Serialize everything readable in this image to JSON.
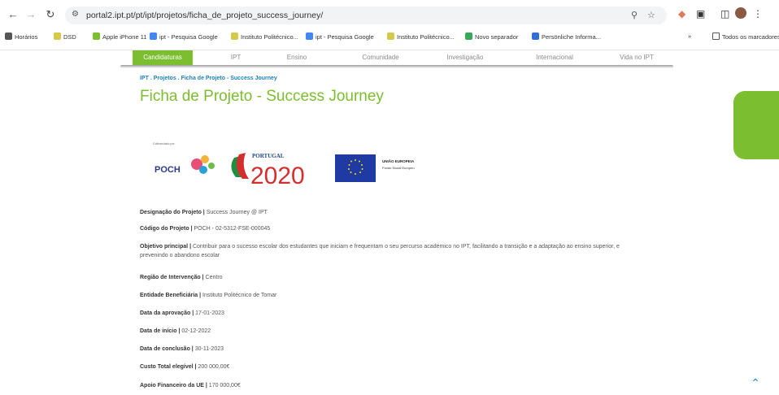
{
  "browser": {
    "url": "portal2.ipt.pt/pt/ipt/projetos/ficha_de_projeto_success_journey/",
    "bookmarks": [
      {
        "label": "Horários",
        "color": "#555"
      },
      {
        "label": "DSD",
        "color": "#d6c94a"
      },
      {
        "label": "Apple iPhone 11",
        "color": "#7bbe2f"
      },
      {
        "label": "ipt - Pesquisa Google",
        "color": "#4285f4"
      },
      {
        "label": "Instituto Politécnico...",
        "color": "#d6c94a"
      },
      {
        "label": "ipt - Pesquisa Google",
        "color": "#4285f4"
      },
      {
        "label": "Instituto Politécnico...",
        "color": "#d6c94a"
      },
      {
        "label": "Novo separador",
        "color": "#3aa757"
      },
      {
        "label": "Persönliche Informa...",
        "color": "#2f6fd6"
      }
    ],
    "bookmarks_more": "»",
    "bookmarks_folder": "Todos os marcadores"
  },
  "site_nav": {
    "items": [
      "Candidaturas",
      "IPT",
      "Ensino",
      "Comunidade",
      "Investigação",
      "Internacional",
      "Vida no IPT"
    ],
    "active_index": 0,
    "accent": "#7bbe2f"
  },
  "page": {
    "breadcrumb": "IPT . Projetos . Ficha de Projeto - Success Journey",
    "title": "Ficha de Projeto - Success Journey",
    "logos": {
      "cofinanced_label": "Cofinanciado por:",
      "poch": "POCH",
      "portugal": "PORTUGAL",
      "year": "2020",
      "eu_title": "UNIÃO EUROPEIA",
      "eu_sub": "Fundo Social Europeu"
    },
    "fields": [
      {
        "label": "Designação do Projeto |",
        "value": " Success Journey @ IPT"
      },
      {
        "label": "Código do Projeto |",
        "value": " POCH - 02-5312-FSE-000045"
      },
      {
        "label": "Objetivo principal |",
        "value": " Contribuir para o sucesso escolar dos estudantes que iniciam e frequentam o seu percurso académico no IPT, facilitando a transição e a adaptação ao ensino superior, e prevenindo o abandono escolar"
      },
      {
        "label": "Região de Intervenção |",
        "value": " Centro"
      },
      {
        "label": "Entidade Beneficiária |",
        "value": " Instituto Politécnico de Tomar"
      },
      {
        "label": "Data da aprovação |",
        "value": " 17-01-2023"
      },
      {
        "label": "Data de início |",
        "value": " 02-12-2022"
      },
      {
        "label": "Data de conclusão |",
        "value": " 30-11-2023"
      },
      {
        "label": "Custo Total elegível |",
        "value": " 200 000,00€"
      },
      {
        "label": "Apoio Financeiro da UE |",
        "value": " 170 000,00€"
      }
    ]
  }
}
